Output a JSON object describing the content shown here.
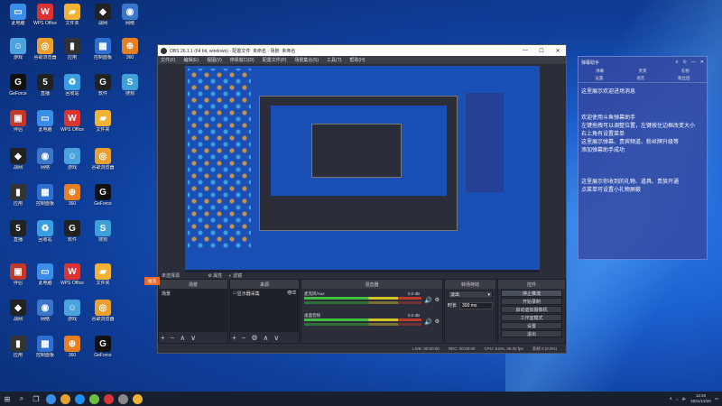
{
  "desktop": {
    "icons": [
      {
        "label": "此电脑",
        "color": "#3b8ee8",
        "glyph": "▭"
      },
      {
        "label": "WPS Office",
        "color": "#d33",
        "glyph": "W"
      },
      {
        "label": "文件夹",
        "color": "#f2b233",
        "glyph": "▰"
      },
      {
        "label": "战网",
        "color": "#222",
        "glyph": "◆"
      },
      {
        "label": "网络",
        "color": "#3a77c9",
        "glyph": "◉"
      },
      {
        "label": "游戏",
        "color": "#4aa3df",
        "glyph": "☺"
      },
      {
        "label": "谷歌浏览器",
        "color": "#e8a030",
        "glyph": "◎"
      },
      {
        "label": "应用",
        "color": "#333",
        "glyph": "▮"
      },
      {
        "label": "控制面板",
        "color": "#2f6fd0",
        "glyph": "▦"
      },
      {
        "label": "360",
        "color": "#e67e22",
        "glyph": "⊕"
      },
      {
        "label": "GeForce",
        "color": "#111",
        "glyph": "G"
      },
      {
        "label": "直播",
        "color": "#222",
        "glyph": "5"
      },
      {
        "label": "回收站",
        "color": "#3a9fe0",
        "glyph": "♻"
      },
      {
        "label": "软件",
        "color": "#222",
        "glyph": "G"
      },
      {
        "label": "搜狗",
        "color": "#3fa0d8",
        "glyph": "S"
      },
      {
        "label": "伴侣",
        "color": "#c0392b",
        "glyph": "▣"
      }
    ]
  },
  "obs": {
    "title": "OBS 26.1.1 (64 bit, windows) - 配置文件: 未命名 - 场景: 未命名",
    "menu": [
      "文件(F)",
      "编辑(E)",
      "视图(V)",
      "停靠窗口(D)",
      "配置文件(P)",
      "场景集合(S)",
      "工具(T)",
      "帮助(H)"
    ],
    "tab_strip": "未选择源",
    "tab_props": "属性",
    "tab_filters": "滤镜",
    "scenes_header": "场景",
    "scene_item": "场景",
    "sources_header": "来源",
    "source_item": "显示器采集",
    "mixer_header": "混音器",
    "mixer_track1": "桌面音频",
    "mixer_track1_db": "0.0 dB",
    "mixer_track2": "麦克风/Aux",
    "mixer_track2_db": "0.0 dB",
    "transitions_header": "转场特效",
    "transition_value": "淡出",
    "duration_label": "时长",
    "duration_value": "300 ms",
    "controls_header": "控件",
    "controls": [
      "停止推流",
      "开始录制",
      "启动虚拟摄像机",
      "工作室模式",
      "设置",
      "退出"
    ],
    "status": [
      "LIVE: 00:00:00",
      "REC: 00:00:00",
      "CPU: 5.6%, 30.00 fps",
      "丢帧 0 (0.0%)"
    ]
  },
  "side_tag": "推流",
  "danmu": {
    "title": "弹幕助手",
    "tabs1": [
      "弹幕",
      "贵宾",
      "礼物"
    ],
    "tabs2": [
      "设置",
      "语音",
      "粉丝团"
    ],
    "messages": [
      "这里展示欢迎进场消息",
      "欢迎使用斗鱼弹幕助手\n左键拖拽可以调整位置，左键按住边框改变大小\n右上角有设置菜单\n这里展示弹幕、贵宾频道、粉丝牌升级等\n添加弹幕助手成功",
      "这里展示你收到的礼物、道具、贵族开通\n点菜单可设置小礼物屏蔽"
    ]
  },
  "taskbar": {
    "time": "12:40",
    "date": "2021/12/20",
    "apps": [
      "#3b8ee8",
      "#e8a030",
      "#1f8ef0",
      "#6bc13b",
      "#d33",
      "#888",
      "#f2b233"
    ]
  }
}
